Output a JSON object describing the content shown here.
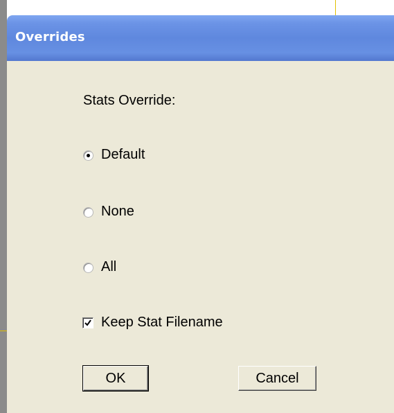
{
  "window": {
    "title": "Overrides"
  },
  "stats_override": {
    "heading": "Stats Override:",
    "options": [
      {
        "label": "Default",
        "selected": true
      },
      {
        "label": "None",
        "selected": false
      },
      {
        "label": "All",
        "selected": false
      }
    ]
  },
  "keep_stat_filename": {
    "label": "Keep Stat Filename",
    "checked": true
  },
  "buttons": {
    "ok_label": "OK",
    "cancel_label": "Cancel"
  },
  "colors": {
    "titlebar": "#6b93e6",
    "dialog_face": "#ece9d8",
    "title_text": "#ffffff"
  }
}
